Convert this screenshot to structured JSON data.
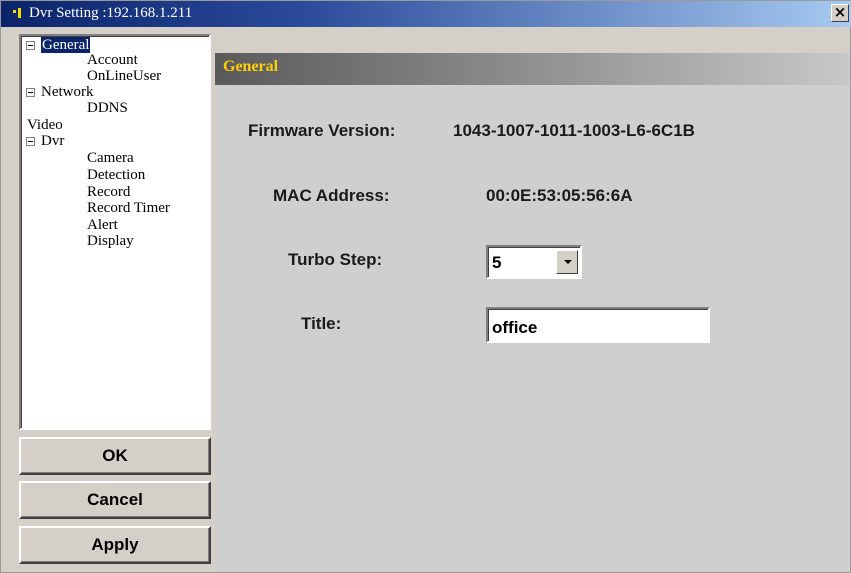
{
  "window": {
    "title": "Dvr Setting :192.168.1.211",
    "close_label": "×"
  },
  "tree": {
    "items": [
      {
        "label": "General",
        "expander": true,
        "selected": true
      },
      {
        "label": "Account"
      },
      {
        "label": "OnLineUser"
      },
      {
        "label": "Network",
        "expander": true
      },
      {
        "label": "DDNS"
      },
      {
        "label": "Video"
      },
      {
        "label": "Dvr",
        "expander": true
      },
      {
        "label": "Camera"
      },
      {
        "label": "Detection"
      },
      {
        "label": "Record"
      },
      {
        "label": "Record Timer"
      },
      {
        "label": "Alert"
      },
      {
        "label": "Display"
      }
    ]
  },
  "buttons": {
    "ok": "OK",
    "cancel": "Cancel",
    "apply": "Apply"
  },
  "panel": {
    "title": "General",
    "firmware_label": "Firmware Version:",
    "firmware_value": "1043-1007-1011-1003-L6-6C1B",
    "mac_label": "MAC Address:",
    "mac_value": "00:0E:53:05:56:6A",
    "turbo_label": "Turbo Step:",
    "turbo_value": "5",
    "title_label": "Title:",
    "title_value": "office"
  },
  "colors": {
    "titlebar_start": "#0a246a",
    "panel_title": "#ffd000",
    "window_bg": "#d4d0c8"
  }
}
